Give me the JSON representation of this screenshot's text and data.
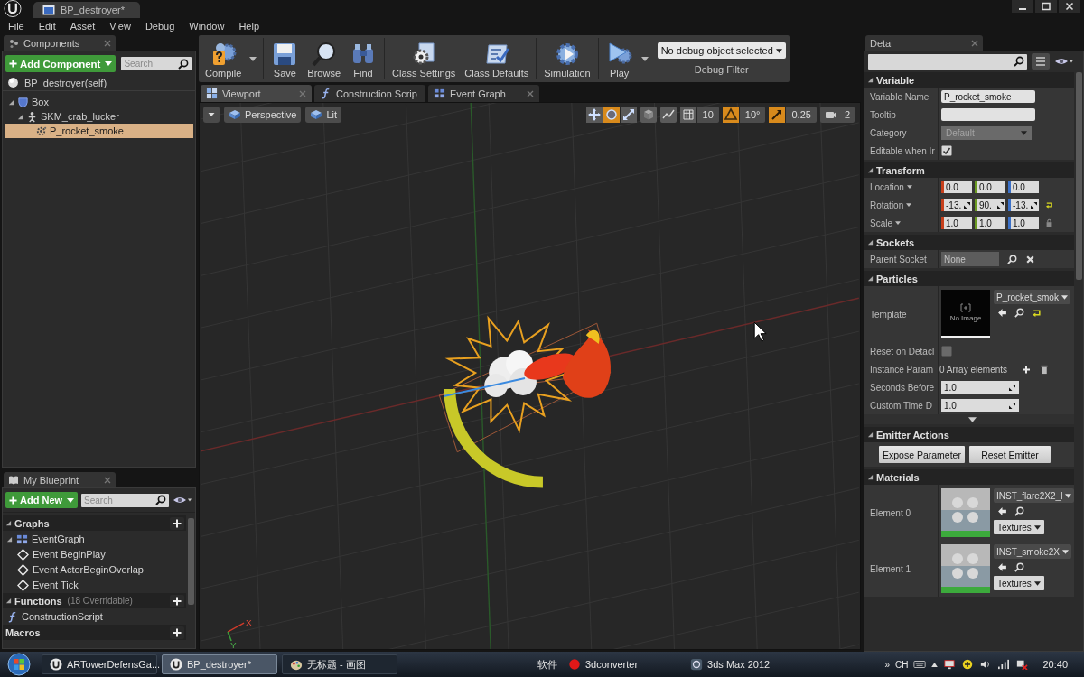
{
  "title_bar": {
    "tab": "BP_destroyer*"
  },
  "menu": [
    "File",
    "Edit",
    "Asset",
    "View",
    "Debug",
    "Window",
    "Help"
  ],
  "components": {
    "tab": "Components",
    "add_button": "Add Component",
    "search": {
      "placeholder": "Search"
    },
    "root": "BP_destroyer(self)",
    "tree": [
      {
        "label": "Box",
        "kind": "box",
        "selected": false,
        "expanded": true,
        "children": [
          {
            "label": "SKM_crab_lucker",
            "kind": "skeletal_mesh",
            "selected": false,
            "expanded": true,
            "children": [
              {
                "label": "P_rocket_smoke",
                "kind": "particle",
                "selected": true
              }
            ]
          }
        ]
      }
    ]
  },
  "toolbar": {
    "groups": [
      [
        {
          "label": "Compile",
          "kind": "compile",
          "dropdown": true
        }
      ],
      [
        {
          "label": "Save",
          "kind": "save"
        },
        {
          "label": "Browse",
          "kind": "browse"
        },
        {
          "label": "Find",
          "kind": "find"
        }
      ],
      [
        {
          "label": "Class Settings",
          "kind": "class_settings"
        },
        {
          "label": "Class Defaults",
          "kind": "class_defaults"
        }
      ],
      [
        {
          "label": "Simulation",
          "kind": "simulation"
        }
      ],
      [
        {
          "label": "Play",
          "kind": "play",
          "dropdown": true
        }
      ]
    ],
    "debug_filter": {
      "value": "No debug object selected",
      "label": "Debug Filter"
    }
  },
  "editor_tabs": [
    {
      "label": "Viewport",
      "kind": "viewport",
      "selected": true
    },
    {
      "label": "Construction Scrip",
      "kind": "function",
      "selected": false
    },
    {
      "label": "Event Graph",
      "kind": "graph",
      "selected": false
    }
  ],
  "viewport": {
    "view_mode": "Perspective",
    "lighting": "Lit",
    "transform_modes": [
      {
        "kind": "translate",
        "selected": false
      },
      {
        "kind": "rotate",
        "selected": true
      },
      {
        "kind": "scale",
        "selected": false
      }
    ],
    "snaps": [
      {
        "kind": "grid",
        "on": false,
        "value": "10"
      },
      {
        "kind": "rotation",
        "on": true,
        "value": "10°"
      },
      {
        "kind": "scale",
        "on": true,
        "value": "0.25"
      }
    ],
    "camera_speed": "2",
    "axes": {
      "x": "X",
      "y": "Y"
    }
  },
  "details": {
    "tab": "Detai",
    "sections": [
      {
        "title": "Variable",
        "expanded": true,
        "rows": [
          {
            "kind": "text",
            "label": "Variable Name",
            "value": "P_rocket_smoke"
          },
          {
            "kind": "text",
            "label": "Tooltip"
          },
          {
            "kind": "dropdown",
            "label": "Category",
            "value": "Default",
            "disabled": true
          },
          {
            "kind": "checkbox",
            "label": "Editable when Ir",
            "checked": true
          }
        ]
      },
      {
        "title": "Transform",
        "expanded": true,
        "rows": [
          {
            "kind": "vector",
            "label": "Location",
            "label_menu": true,
            "values": [
              "0.0",
              "0.0",
              "0.0"
            ]
          },
          {
            "kind": "vector",
            "label": "Rotation",
            "label_menu": true,
            "values": [
              "-13.",
              "90.",
              "-13."
            ],
            "spinners": true,
            "reset": true
          },
          {
            "kind": "vector",
            "label": "Scale",
            "label_menu": true,
            "values": [
              "1.0",
              "1.0",
              "1.0"
            ],
            "lock": true
          }
        ]
      },
      {
        "title": "Sockets",
        "expanded": true,
        "rows": [
          {
            "kind": "socket",
            "label": "Parent Socket",
            "value": "None"
          }
        ]
      },
      {
        "title": "Particles",
        "expanded": true,
        "advanced": true,
        "rows": [
          {
            "kind": "asset",
            "label": "Template",
            "value": "P_rocket_smok",
            "thumbnail_text": "No Image"
          },
          {
            "kind": "checkbox",
            "label": "Reset on Detacl",
            "checked": false
          },
          {
            "kind": "array",
            "label": "Instance Param",
            "value": "0 Array elements"
          },
          {
            "kind": "number",
            "label": "Seconds Before",
            "value": "1.0"
          },
          {
            "kind": "number",
            "label": "Custom Time D",
            "value": "1.0"
          }
        ]
      },
      {
        "title": "Emitter Actions",
        "expanded": true,
        "rows": [
          {
            "kind": "buttons",
            "buttons": [
              "Expose Parameter",
              "Reset Emitter"
            ]
          }
        ]
      },
      {
        "title": "Materials",
        "expanded": true,
        "rows": [
          {
            "kind": "material",
            "label": "Element 0",
            "value": "INST_flare2X2_l",
            "button": "Textures"
          },
          {
            "kind": "material",
            "label": "Element 1",
            "value": "INST_smoke2X",
            "button": "Textures"
          }
        ]
      }
    ]
  },
  "my_blueprint": {
    "tab": "My Blueprint",
    "add_button": "Add New",
    "search": {
      "placeholder": "Search"
    },
    "sections": [
      {
        "title": "Graphs",
        "expanded": true,
        "items": [
          {
            "label": "EventGraph",
            "kind": "graph",
            "selected": false,
            "expanded": true,
            "children": [
              {
                "label": "Event BeginPlay",
                "kind": "event",
                "selected": false
              },
              {
                "label": "Event ActorBeginOverlap",
                "kind": "event",
                "selected": false
              },
              {
                "label": "Event Tick",
                "kind": "event",
                "selected": false
              }
            ]
          }
        ]
      },
      {
        "title": "Functions",
        "note": "(18 Overridable)",
        "expanded": true,
        "items": [
          {
            "label": "ConstructionScript",
            "kind": "function",
            "selected": false
          }
        ]
      },
      {
        "title": "Macros"
      }
    ]
  },
  "taskbar": {
    "windows": [
      {
        "label": "ARTowerDefensGa...",
        "kind": "unreal",
        "selected": false
      },
      {
        "label": "BP_destroyer*",
        "kind": "unreal",
        "selected": true
      },
      {
        "label": "无标题 - 画图",
        "kind": "paint",
        "selected": false
      }
    ],
    "toolbar_label": "软件",
    "shortcuts": [
      {
        "label": "3dconverter",
        "kind": "converter"
      },
      {
        "label": "3ds Max 2012",
        "kind": "max"
      }
    ],
    "tray": {
      "more": "»",
      "language": "CH",
      "time": "20:40"
    }
  }
}
